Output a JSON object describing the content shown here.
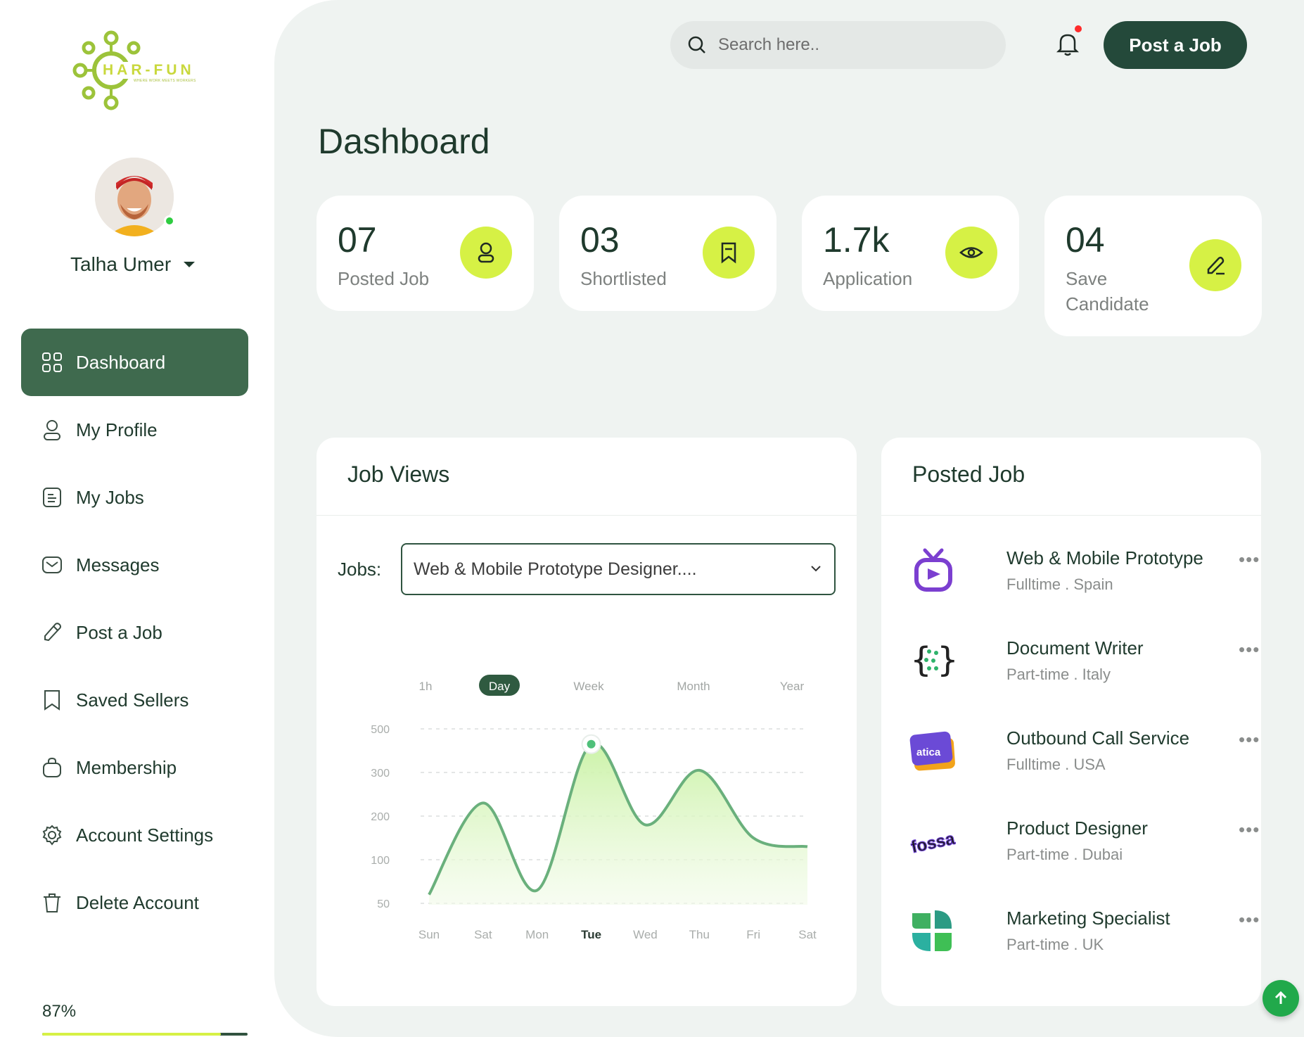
{
  "brand": {
    "name": "HAR-FUN",
    "tagline": "WHERE WORK MEETS WORKERS",
    "accent": "#d6f145",
    "primary": "#24493a"
  },
  "user": {
    "name": "Talha Umer",
    "status": "online"
  },
  "sidebar": {
    "items": [
      {
        "label": "Dashboard",
        "icon": "grid-icon",
        "active": true
      },
      {
        "label": "My Profile",
        "icon": "user-icon",
        "active": false
      },
      {
        "label": "My Jobs",
        "icon": "document-icon",
        "active": false
      },
      {
        "label": "Messages",
        "icon": "mail-icon",
        "active": false
      },
      {
        "label": "Post a Job",
        "icon": "pencil-icon",
        "active": false
      },
      {
        "label": "Saved Sellers",
        "icon": "bookmark-icon",
        "active": false
      },
      {
        "label": "Membership",
        "icon": "bag-icon",
        "active": false
      },
      {
        "label": "Account Settings",
        "icon": "gear-icon",
        "active": false
      },
      {
        "label": "Delete Account",
        "icon": "trash-icon",
        "active": false
      }
    ],
    "profile_completion": {
      "label": "87%",
      "value": 0.87
    }
  },
  "header": {
    "search_placeholder": "Search here..",
    "post_job_label": "Post a Job",
    "notification_dot": true
  },
  "page": {
    "title": "Dashboard"
  },
  "stats": [
    {
      "value": "07",
      "label": "Posted Job",
      "icon": "user-icon"
    },
    {
      "value": "03",
      "label": "Shortlisted",
      "icon": "bookmark-icon"
    },
    {
      "value": "1.7k",
      "label": "Application",
      "icon": "eye-icon"
    },
    {
      "value": "04",
      "label": "Save Candidate",
      "icon": "pencil-icon"
    }
  ],
  "job_views": {
    "title": "Job Views",
    "jobs_label": "Jobs:",
    "selected_job": "Web & Mobile Prototype Designer....",
    "periods": [
      "1h",
      "Day",
      "Week",
      "Month",
      "Year"
    ],
    "active_period": "Day"
  },
  "chart_data": {
    "type": "area",
    "title": "Job Views",
    "categories": [
      "Sun",
      "Sat",
      "Mon",
      "Tue",
      "Wed",
      "Thu",
      "Fri",
      "Sat"
    ],
    "highlight_category": "Tue",
    "y_ticks": [
      500,
      300,
      200,
      100,
      50
    ],
    "series": [
      {
        "values": [
          60,
          230,
          65,
          430,
          180,
          310,
          150,
          130
        ]
      }
    ],
    "color": "#6ab07c",
    "grid": true
  },
  "posted_jobs": {
    "title": "Posted Job",
    "items": [
      {
        "title": "Web & Mobile Prototype",
        "type": "Fulltime",
        "location": "Spain",
        "logo": "tv-logo"
      },
      {
        "title": "Document Writer",
        "type": "Part-time",
        "location": "Italy",
        "logo": "braces-logo"
      },
      {
        "title": "Outbound Call Service",
        "type": "Fulltime",
        "location": "USA",
        "logo": "atica-logo",
        "logo_text": "atica"
      },
      {
        "title": "Product Designer",
        "type": "Part-time",
        "location": "Dubai",
        "logo": "fossa-logo",
        "logo_text": "fossa"
      },
      {
        "title": "Marketing Specialist",
        "type": "Part-time",
        "location": "UK",
        "logo": "clover-logo"
      }
    ],
    "more_label": "•••"
  }
}
